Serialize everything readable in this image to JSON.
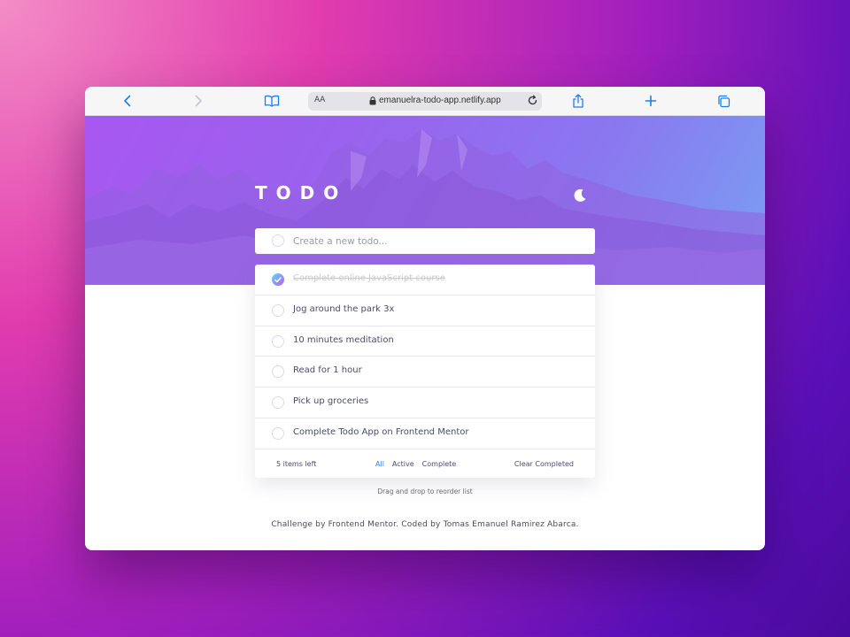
{
  "browser": {
    "text_size_label": "AA",
    "url": "emanuelra-todo-app.netlify.app",
    "icons": [
      "back-icon",
      "forward-icon",
      "book-icon",
      "lock-icon",
      "reload-icon",
      "share-icon",
      "plus-icon",
      "tabs-icon"
    ]
  },
  "app": {
    "title": "TODO",
    "theme_icon": "moon-icon",
    "new_todo_placeholder": "Create a new todo...",
    "todos": [
      {
        "text": "Complete online JavaScript course",
        "completed": true
      },
      {
        "text": "Jog around the park 3x",
        "completed": false
      },
      {
        "text": "10 minutes meditation",
        "completed": false
      },
      {
        "text": "Read for 1 hour",
        "completed": false
      },
      {
        "text": "Pick up groceries",
        "completed": false
      },
      {
        "text": "Complete Todo App on Frontend Mentor",
        "completed": false
      }
    ],
    "items_left": "5 items left",
    "filters": [
      {
        "label": "All",
        "active": true
      },
      {
        "label": "Active",
        "active": false
      },
      {
        "label": "Complete",
        "active": false
      }
    ],
    "clear_label": "Clear Completed",
    "hint": "Drag and drop to reorder list",
    "credit": "Challenge by Frontend Mentor. Coded by Tomas Emanuel Ramirez Abarca."
  },
  "colors": {
    "accent": "#3a7bfd",
    "check_gradient_start": "#57ddff",
    "check_gradient_end": "#c058f3",
    "text": "#494c6b",
    "completed_text": "#c9c9d3"
  }
}
